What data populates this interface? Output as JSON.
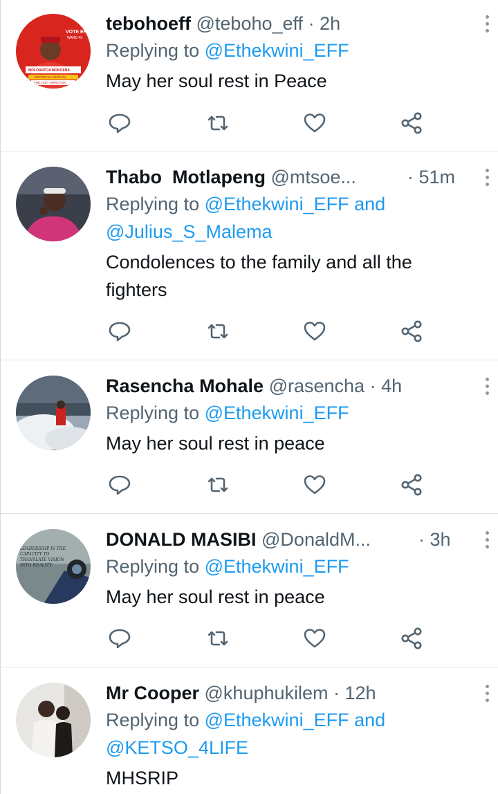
{
  "colors": {
    "link": "#1d9bf0",
    "secondary": "#536471",
    "text": "#0f1419"
  },
  "tweets": [
    {
      "name": "tebohoeff",
      "handle": "@teboho_eff",
      "time": "· 2h",
      "replying_prefix": "Replying to",
      "mentions": [
        "@Ethekwini_EFF"
      ],
      "text_lines": [
        "May her soul rest in Peace"
      ],
      "avatar_text": [
        "VOTE EFF",
        "WARD 49",
        "MOLOANTOA MOKOENA",
        "VICTORY IS CERTAIN",
        "THE LAST HOPE FOR"
      ]
    },
    {
      "name": "Thabo  Motlapeng",
      "handle": "@mtsoe...",
      "time": "· 51m",
      "replying_prefix": "Replying to",
      "mentions": [
        "@Ethekwini_EFF",
        "@Julius_S_Malema"
      ],
      "joiner": "and",
      "text_lines": [
        "Condolences to the family and all the",
        "fighters"
      ]
    },
    {
      "name": "Rasencha Mohale",
      "handle": "@rasencha",
      "time": "· 4h",
      "replying_prefix": "Replying to",
      "mentions": [
        "@Ethekwini_EFF"
      ],
      "text_lines": [
        "May her soul rest in peace"
      ]
    },
    {
      "name": "DONALD MASIBI",
      "handle": "@DonaldM...",
      "time": "· 3h",
      "replying_prefix": "Replying to",
      "mentions": [
        "@Ethekwini_EFF"
      ],
      "text_lines": [
        "May her soul rest in peace"
      ],
      "avatar_text": [
        "LEADERSHIP IS THE",
        "CAPACITY TO",
        "TRANSLATE VISION",
        "INTO REALITY"
      ]
    },
    {
      "name": "Mr Cooper",
      "handle": "@khuphukilem",
      "time": "· 12h",
      "replying_prefix": "Replying to",
      "mentions": [
        "@Ethekwini_EFF",
        "@KETSO_4LIFE"
      ],
      "joiner": "and",
      "text_lines": [
        "MHSRIP"
      ]
    }
  ],
  "action_icons": [
    "reply-icon",
    "retweet-icon",
    "like-icon",
    "share-icon"
  ]
}
